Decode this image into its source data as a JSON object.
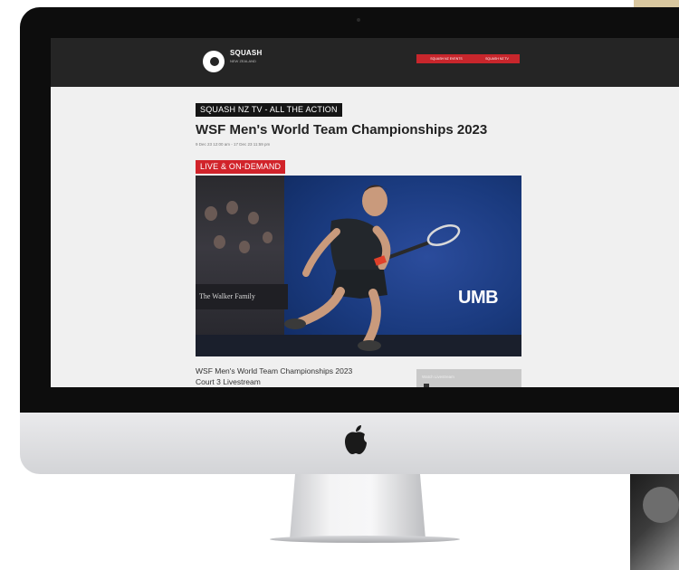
{
  "header": {
    "logo_text": "SQUASH",
    "logo_subtext": "NEW ZEALAND",
    "nav_buttons": [
      "SQUASH NZ EVENTS",
      "SQUASH NZ TV"
    ]
  },
  "page": {
    "section_label": "SQUASH NZ TV - ALL THE ACTION",
    "title": "WSF Men's World Team Championships 2023",
    "dates": "9 Dec 23 12:00 am - 17 Dec 23 11:59 pm",
    "badge": "LIVE & ON-DEMAND"
  },
  "video": {
    "sponsor_board": "The Walker Family",
    "court_logo": "UMB"
  },
  "stream": {
    "title_line1": "WSF Men's World Team Championships 2023",
    "title_line2": "Court 3 Livestream",
    "side_card_text": "Watch Livestream"
  },
  "colors": {
    "header_bg": "#252525",
    "accent_red": "#c8262c",
    "court_blue": "#1a3a7e",
    "screen_bg": "#f0f0f0"
  }
}
